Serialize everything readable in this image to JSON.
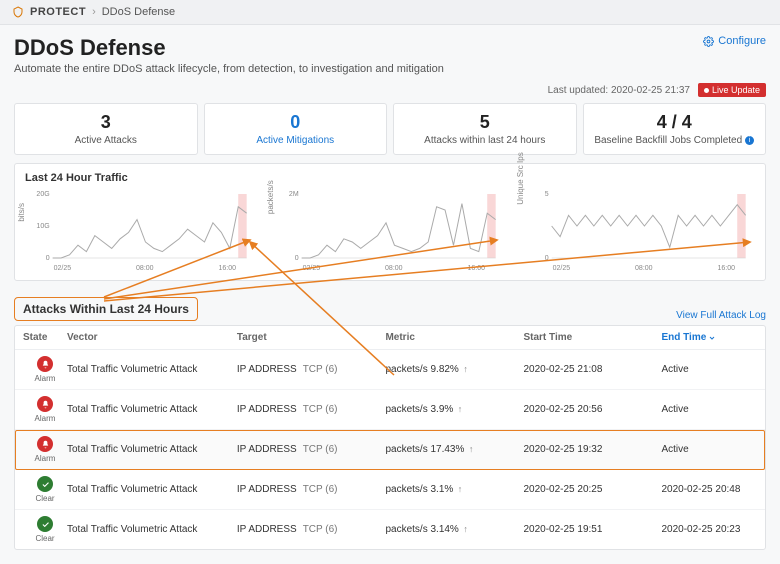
{
  "breadcrumb": {
    "root": "PROTECT",
    "current": "DDoS Defense"
  },
  "header": {
    "title": "DDoS Defense",
    "subtitle": "Automate the entire DDoS attack lifecycle, from detection, to investigation and mitigation",
    "configure": "Configure"
  },
  "meta": {
    "last_updated": "Last updated: 2020-02-25 21:37",
    "live_update": "Live Update"
  },
  "stats": {
    "active_attacks": {
      "value": "3",
      "label": "Active Attacks"
    },
    "active_mitigations": {
      "value": "0",
      "label": "Active Mitigations"
    },
    "attacks24": {
      "value": "5",
      "label": "Attacks within last 24 hours"
    },
    "baseline": {
      "value": "4 / 4",
      "label": "Baseline Backfill Jobs Completed"
    }
  },
  "charts": {
    "title": "Last 24 Hour Traffic"
  },
  "chart_data": [
    {
      "type": "line",
      "title": "",
      "ylabel": "bits/s",
      "xticks": [
        "02/25",
        "08:00",
        "16:00"
      ],
      "yticks": [
        "0",
        "10G",
        "20G"
      ],
      "ylim": [
        0,
        20
      ],
      "x": [
        0,
        1,
        2,
        3,
        4,
        5,
        6,
        7,
        8,
        9,
        10,
        11,
        12,
        13,
        14,
        15,
        16,
        17,
        18,
        19,
        20,
        21,
        22,
        23
      ],
      "values": [
        0,
        0,
        1,
        4,
        2,
        7,
        5,
        3,
        6,
        8,
        12,
        5,
        3,
        2,
        4,
        6,
        9,
        7,
        5,
        11,
        8,
        3,
        16,
        14
      ],
      "highlight_range": [
        22,
        24
      ]
    },
    {
      "type": "line",
      "title": "",
      "ylabel": "packets/s",
      "xticks": [
        "02/25",
        "08:00",
        "16:00"
      ],
      "yticks": [
        "0",
        "2M"
      ],
      "ylim": [
        0,
        2
      ],
      "x": [
        0,
        1,
        2,
        3,
        4,
        5,
        6,
        7,
        8,
        9,
        10,
        11,
        12,
        13,
        14,
        15,
        16,
        17,
        18,
        19,
        20,
        21,
        22,
        23
      ],
      "values": [
        0,
        0,
        0.1,
        0.4,
        0.2,
        0.6,
        0.5,
        0.3,
        0.5,
        0.7,
        1.1,
        0.4,
        0.3,
        0.2,
        0.3,
        0.5,
        1.6,
        1.5,
        0.4,
        1.7,
        0.3,
        0.2,
        1.4,
        1.2
      ],
      "highlight_range": [
        22,
        24
      ]
    },
    {
      "type": "line",
      "title": "",
      "ylabel": "Unique Src Ips",
      "xticks": [
        "02/25",
        "08:00",
        "16:00"
      ],
      "yticks": [
        "0",
        "5"
      ],
      "ylim": [
        0,
        6
      ],
      "x": [
        0,
        1,
        2,
        3,
        4,
        5,
        6,
        7,
        8,
        9,
        10,
        11,
        12,
        13,
        14,
        15,
        16,
        17,
        18,
        19,
        20,
        21,
        22,
        23
      ],
      "values": [
        3,
        2,
        4,
        3,
        4,
        3,
        4,
        3,
        4,
        3,
        4,
        3,
        4,
        3,
        1,
        4,
        3,
        4,
        3,
        4,
        3,
        4,
        5,
        4
      ],
      "highlight_range": [
        22,
        24
      ]
    }
  ],
  "attacks_section": {
    "title": "Attacks Within Last 24 Hours",
    "view_full": "View Full Attack Log"
  },
  "table": {
    "columns": {
      "state": "State",
      "vector": "Vector",
      "target": "Target",
      "metric": "Metric",
      "start": "Start Time",
      "end": "End Time"
    },
    "rows": [
      {
        "state": "Alarm",
        "vector": "Total Traffic Volumetric Attack",
        "target_ip": "IP ADDRESS",
        "target_proto": "TCP (6)",
        "metric": "packets/s 9.82%",
        "start": "2020-02-25 21:08",
        "end": "Active",
        "highlight": false
      },
      {
        "state": "Alarm",
        "vector": "Total Traffic Volumetric Attack",
        "target_ip": "IP ADDRESS",
        "target_proto": "TCP (6)",
        "metric": "packets/s 3.9%",
        "start": "2020-02-25 20:56",
        "end": "Active",
        "highlight": false
      },
      {
        "state": "Alarm",
        "vector": "Total Traffic Volumetric Attack",
        "target_ip": "IP ADDRESS",
        "target_proto": "TCP (6)",
        "metric": "packets/s 17.43%",
        "start": "2020-02-25 19:32",
        "end": "Active",
        "highlight": true
      },
      {
        "state": "Clear",
        "vector": "Total Traffic Volumetric Attack",
        "target_ip": "IP ADDRESS",
        "target_proto": "TCP (6)",
        "metric": "packets/s 3.1%",
        "start": "2020-02-25 20:25",
        "end": "2020-02-25 20:48",
        "highlight": false
      },
      {
        "state": "Clear",
        "vector": "Total Traffic Volumetric Attack",
        "target_ip": "IP ADDRESS",
        "target_proto": "TCP (6)",
        "metric": "packets/s 3.14%",
        "start": "2020-02-25 19:51",
        "end": "2020-02-25 20:23",
        "highlight": false
      }
    ]
  }
}
